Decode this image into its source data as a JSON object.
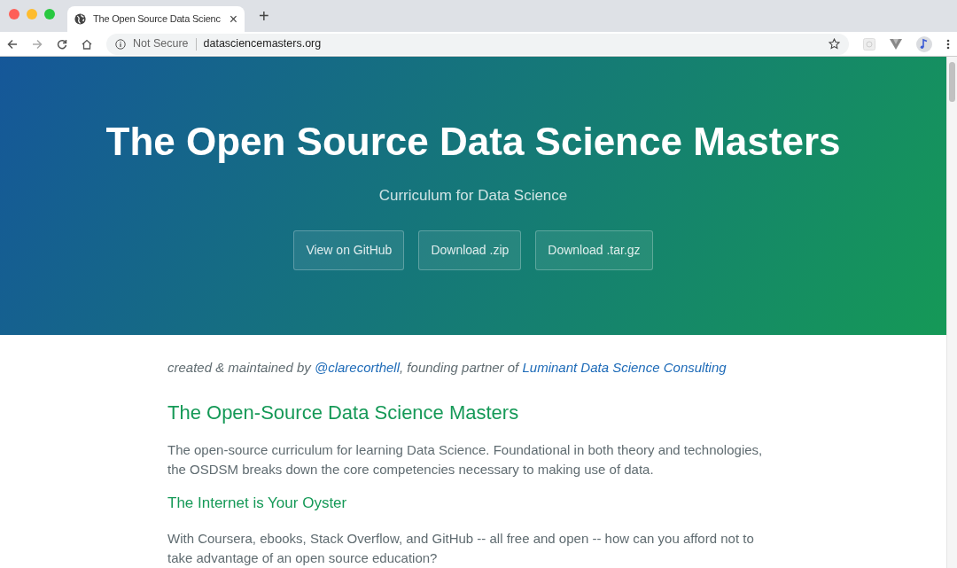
{
  "browser": {
    "tab": {
      "title": "The Open Source Data Scienc",
      "selected": true
    },
    "close_tab": "×",
    "new_tab": "+",
    "security": "Not Secure",
    "url": "datasciencemasters.org"
  },
  "hero": {
    "title": "The Open Source Data Science Masters",
    "tagline": "Curriculum for Data Science",
    "buttons": [
      "View on GitHub",
      "Download .zip",
      "Download .tar.gz"
    ]
  },
  "byline": [
    {
      "kind": "text",
      "text": "created & maintained by "
    },
    {
      "kind": "link",
      "text": "@clarecorthell"
    },
    {
      "kind": "text",
      "text": ", founding partner of "
    },
    {
      "kind": "link",
      "text": "Luminant Data Science Consulting"
    }
  ],
  "content": [
    {
      "kind": "h2",
      "text": "The Open-Source Data Science Masters"
    },
    {
      "kind": "p",
      "text": "The open-source curriculum for learning Data Science. Foundational in both theory and technologies, the OSDSM breaks down the core competencies necessary to making use of data."
    },
    {
      "kind": "h3",
      "text": "The Internet is Your Oyster"
    },
    {
      "kind": "p",
      "text": "With Coursera, ebooks, Stack Overflow, and GitHub -- all free and open -- how can you afford not to take advantage of an open source education?"
    }
  ]
}
